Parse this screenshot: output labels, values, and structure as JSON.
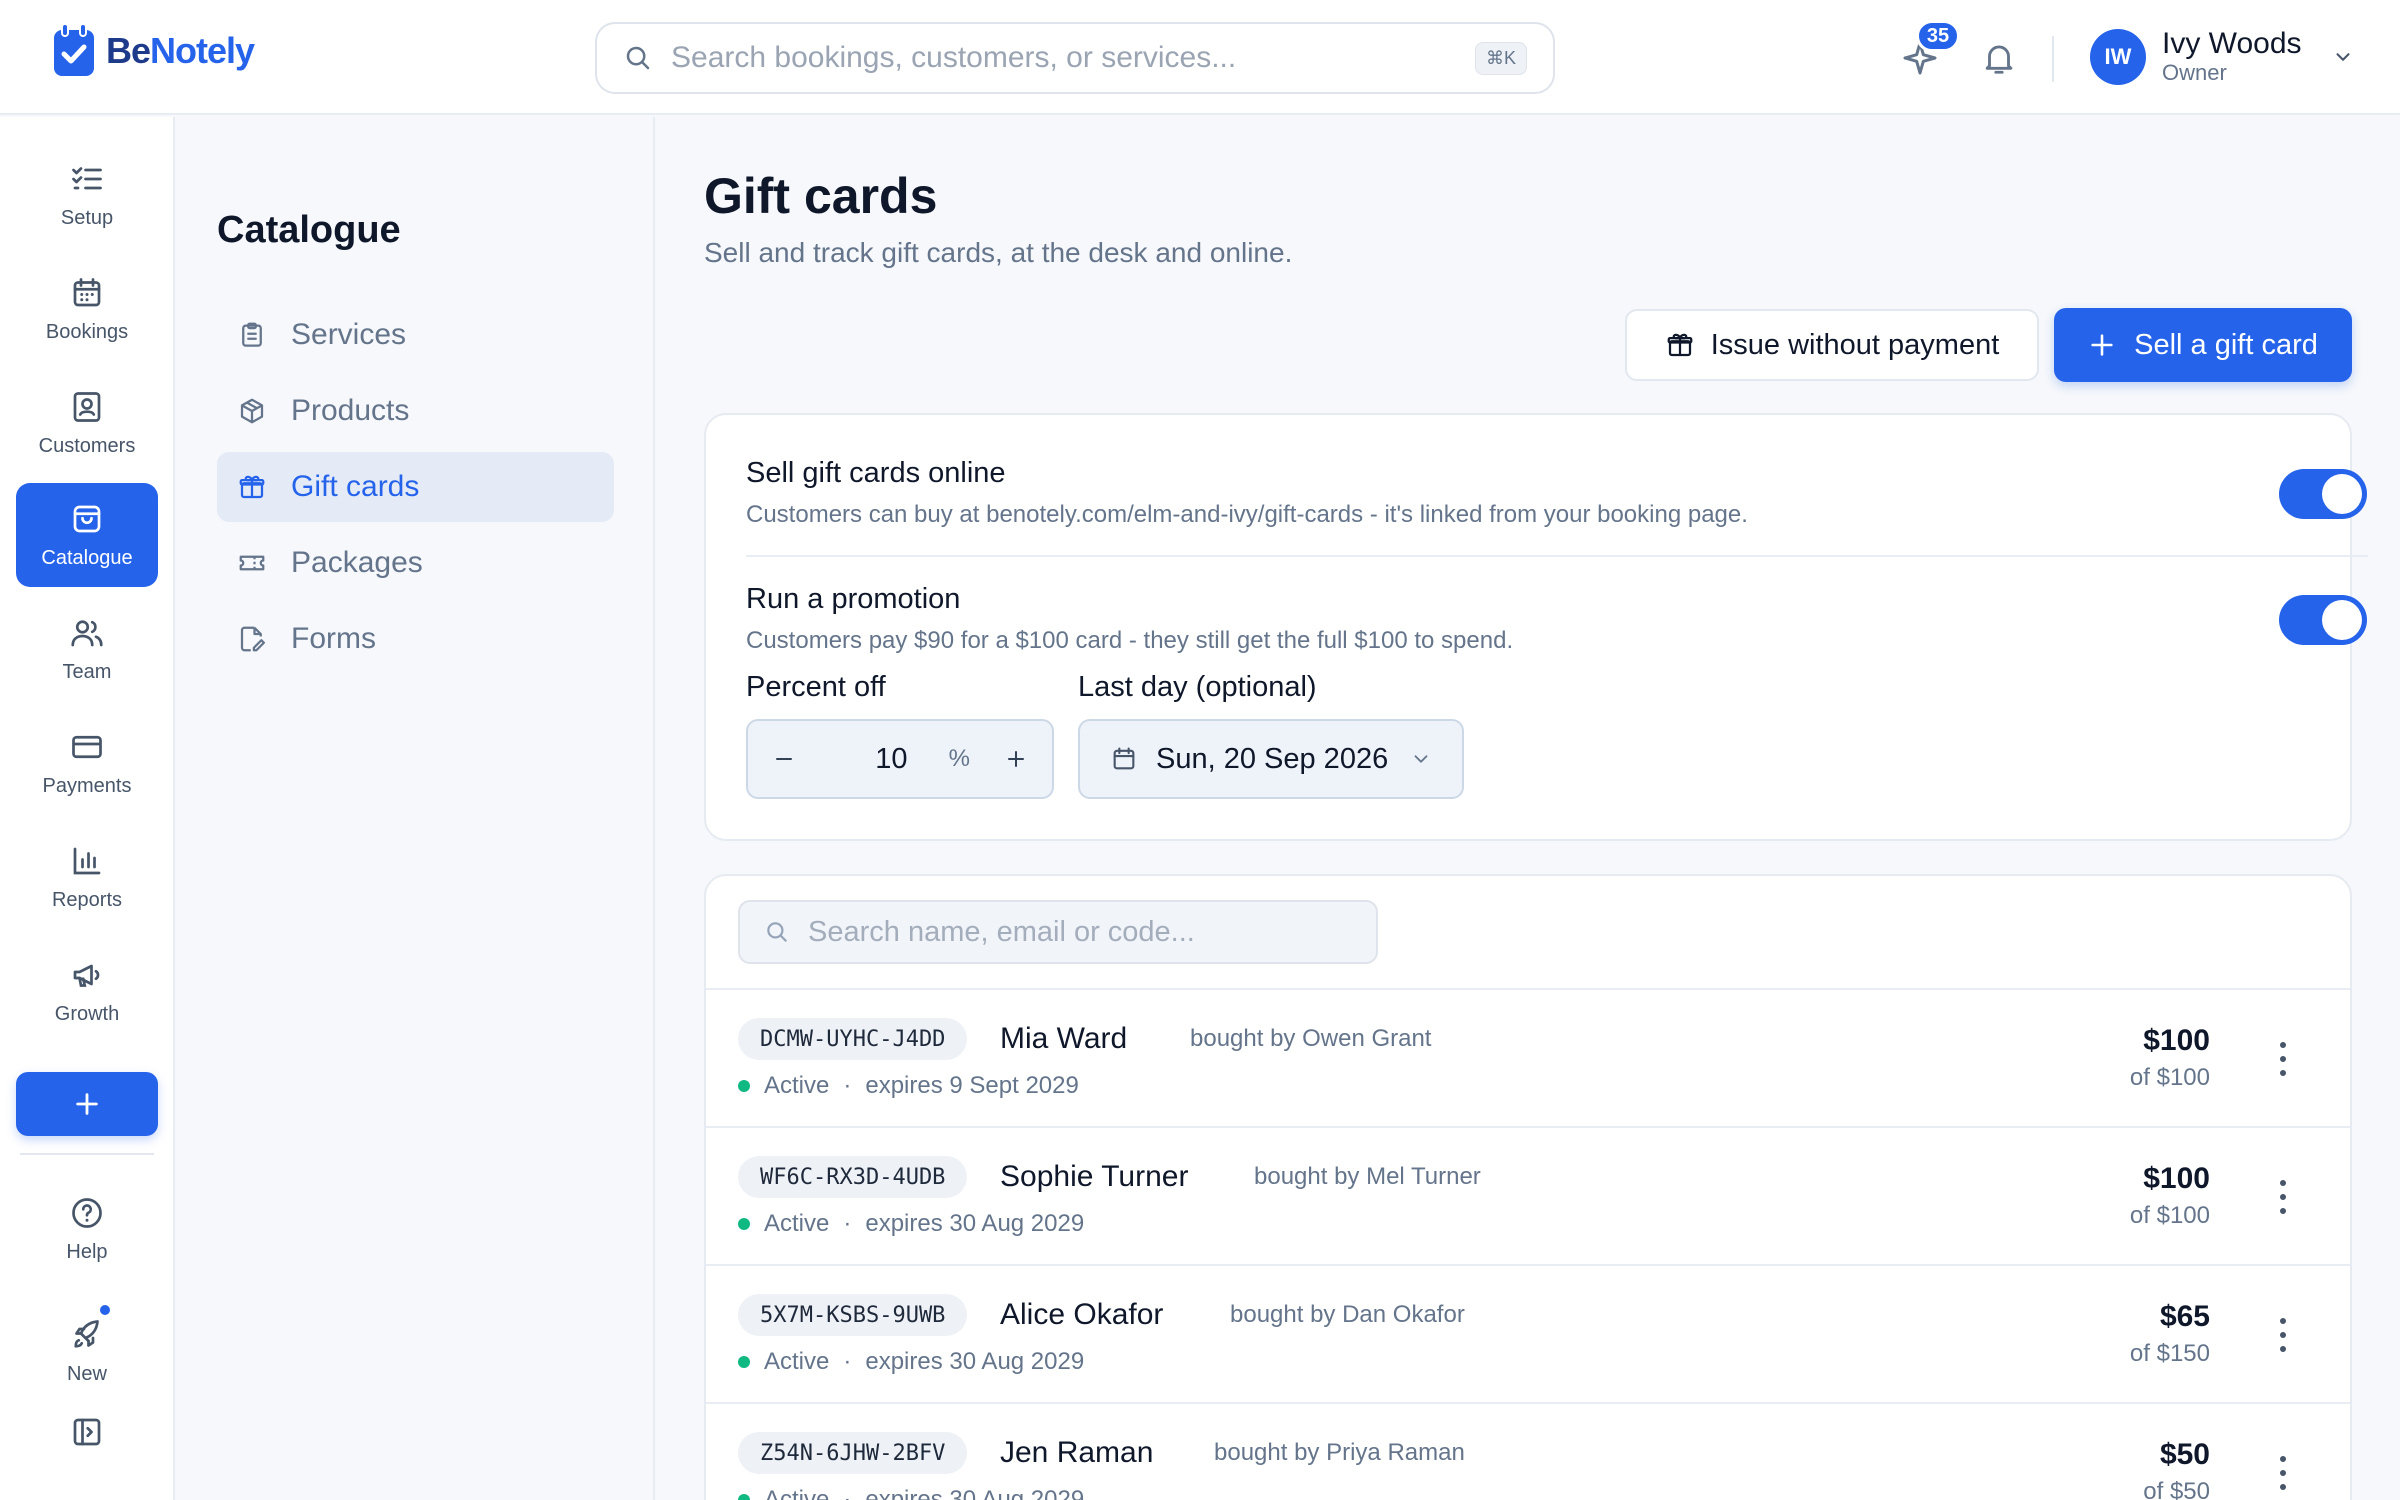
{
  "brand": {
    "name_part1": "Be",
    "name_part2": "Notely",
    "color": "#2563eb"
  },
  "topbar": {
    "search_placeholder": "Search bookings, customers, or services...",
    "search_shortcut": "⌘K",
    "whats_new_count": "35",
    "user": {
      "initials": "IW",
      "name": "Ivy Woods",
      "role": "Owner"
    }
  },
  "rail": {
    "items": [
      {
        "label": "Setup",
        "icon": "checklist-icon"
      },
      {
        "label": "Bookings",
        "icon": "calendar-icon"
      },
      {
        "label": "Customers",
        "icon": "contact-card-icon"
      },
      {
        "label": "Catalogue",
        "icon": "shopping-bag-icon",
        "active": true
      },
      {
        "label": "Team",
        "icon": "users-icon"
      },
      {
        "label": "Payments",
        "icon": "credit-card-icon"
      },
      {
        "label": "Reports",
        "icon": "bar-chart-icon"
      },
      {
        "label": "Growth",
        "icon": "megaphone-icon"
      }
    ],
    "bottom": [
      {
        "label": "Help",
        "icon": "help-circle-icon"
      },
      {
        "label": "New",
        "icon": "rocket-icon"
      }
    ]
  },
  "subnav": {
    "title": "Catalogue",
    "items": [
      {
        "label": "Services",
        "icon": "clipboard-icon"
      },
      {
        "label": "Products",
        "icon": "box-icon"
      },
      {
        "label": "Gift cards",
        "icon": "gift-icon",
        "active": true
      },
      {
        "label": "Packages",
        "icon": "ticket-icon"
      },
      {
        "label": "Forms",
        "icon": "form-edit-icon"
      }
    ]
  },
  "page": {
    "title": "Gift cards",
    "subtitle": "Sell and track gift cards, at the desk and online.",
    "issue_button": "Issue without payment",
    "sell_button": "Sell a gift card"
  },
  "settings": {
    "online": {
      "title": "Sell gift cards online",
      "description": "Customers can buy at benotely.com/elm-and-ivy/gift-cards - it's linked from your booking page.",
      "enabled": true
    },
    "promotion": {
      "title": "Run a promotion",
      "description": "Customers pay $90 for a $100 card - they still get the full $100 to spend.",
      "enabled": true,
      "percent_label": "Percent off",
      "percent_value": "10",
      "percent_unit": "%",
      "last_day_label": "Last day (optional)",
      "last_day_value": "Sun, 20 Sep 2026"
    }
  },
  "list": {
    "search_placeholder": "Search name, email or code...",
    "rows": [
      {
        "code": "DCMW-UYHC-J4DD",
        "name": "Mia Ward",
        "bought_by": "bought by Owen Grant",
        "status": "Active",
        "expires": "expires 9 Sept 2029",
        "amount": "$100",
        "of": "of $100"
      },
      {
        "code": "WF6C-RX3D-4UDB",
        "name": "Sophie Turner",
        "bought_by": "bought by Mel Turner",
        "status": "Active",
        "expires": "expires 30 Aug 2029",
        "amount": "$100",
        "of": "of $100"
      },
      {
        "code": "5X7M-KSBS-9UWB",
        "name": "Alice Okafor",
        "bought_by": "bought by Dan Okafor",
        "status": "Active",
        "expires": "expires 30 Aug 2029",
        "amount": "$65",
        "of": "of $150"
      },
      {
        "code": "Z54N-6JHW-2BFV",
        "name": "Jen Raman",
        "bought_by": "bought by Priya Raman",
        "status": "Active",
        "expires": "expires 30 Aug 2029",
        "amount": "$50",
        "of": "of $50"
      }
    ]
  }
}
